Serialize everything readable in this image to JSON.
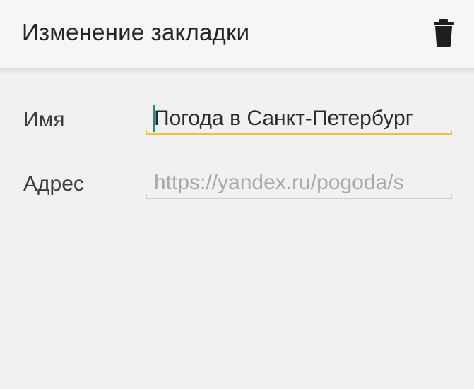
{
  "header": {
    "title": "Изменение закладки",
    "delete_icon": "trash-icon"
  },
  "form": {
    "name": {
      "label": "Имя",
      "value": "Погода в Санкт-Петербург"
    },
    "url": {
      "label": "Адрес",
      "value": "https://yandex.ru/pogoda/s"
    }
  },
  "colors": {
    "background": "#f1f1f1",
    "accent_underline": "#f2c236",
    "cursor": "#1f8e80",
    "inactive_underline": "#cfcfcf"
  }
}
